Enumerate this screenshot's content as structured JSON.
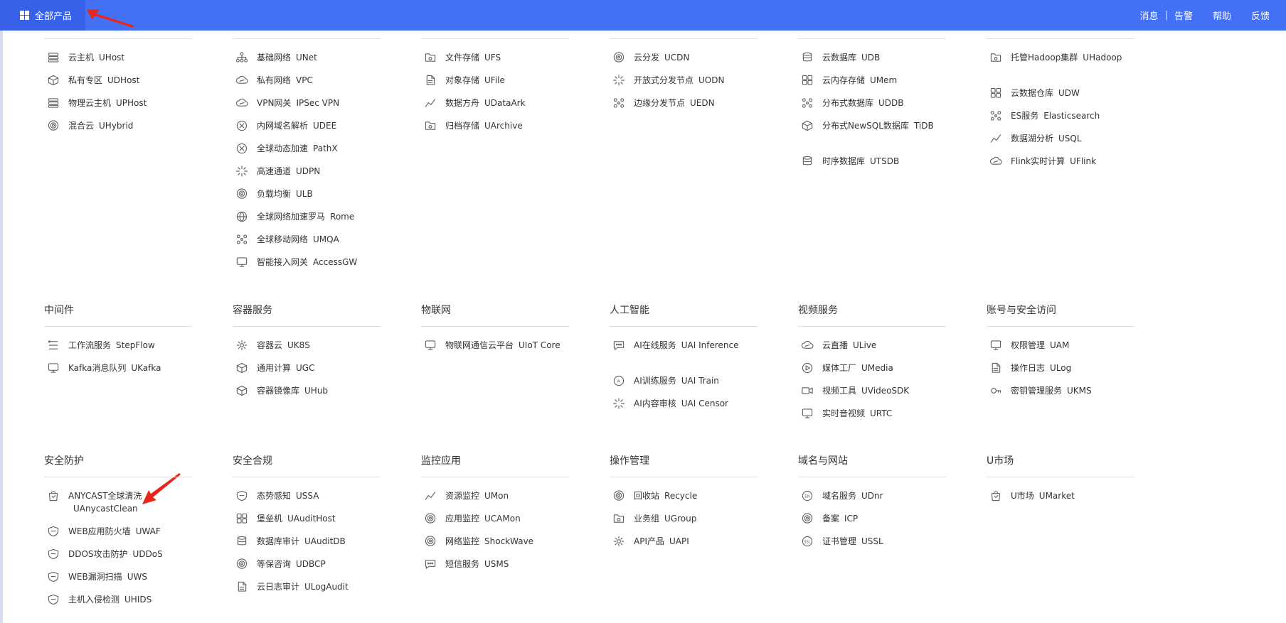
{
  "topbar": {
    "all_products_label": "全部产品",
    "links": [
      "消息",
      "告警",
      "帮助",
      "反馈"
    ]
  },
  "colors": {
    "accent": "#4470f6",
    "accent_dark": "#3761e8",
    "arrow": "#e8261e",
    "icon": "#606266"
  },
  "rows": [
    [
      {
        "title": "",
        "items": [
          {
            "name": "云主机",
            "code": "UHost",
            "icon": "server-icon"
          },
          {
            "name": "私有专区",
            "code": "UDHost",
            "icon": "cube-icon"
          },
          {
            "name": "物理云主机",
            "code": "UPHost",
            "icon": "physical-server-icon"
          },
          {
            "name": "混合云",
            "code": "UHybrid",
            "icon": "target-icon"
          }
        ]
      },
      {
        "title": "",
        "items": [
          {
            "name": "基础网络",
            "code": "UNet",
            "icon": "network-tree-icon"
          },
          {
            "name": "私有网络",
            "code": "VPC",
            "icon": "cloud-link-icon"
          },
          {
            "name": "VPN网关",
            "code": "IPSec VPN",
            "icon": "cloud-link-icon"
          },
          {
            "name": "内网域名解析",
            "code": "UDEE",
            "icon": "dns-icon"
          },
          {
            "name": "全球动态加速",
            "code": "PathX",
            "icon": "accelerate-icon"
          },
          {
            "name": "高速通道",
            "code": "UDPN",
            "icon": "dotted-channel-icon"
          },
          {
            "name": "负载均衡",
            "code": "ULB",
            "icon": "load-balancer-icon"
          },
          {
            "name": "全球网络加速罗马",
            "code": "Rome",
            "icon": "globe-icon"
          },
          {
            "name": "全球移动网络",
            "code": "UMQA",
            "icon": "mobile-network-icon"
          },
          {
            "name": "智能接入网关",
            "code": "AccessGW",
            "icon": "gateway-icon"
          }
        ]
      },
      {
        "title": "",
        "items": [
          {
            "name": "文件存储",
            "code": "UFS",
            "icon": "folder-icon"
          },
          {
            "name": "对象存储",
            "code": "UFile",
            "icon": "file-icon"
          },
          {
            "name": "数据方舟",
            "code": "UDataArk",
            "icon": "ark-icon"
          },
          {
            "name": "归档存储",
            "code": "UArchive",
            "icon": "archive-icon"
          }
        ]
      },
      {
        "title": "",
        "items": [
          {
            "name": "云分发",
            "code": "UCDN",
            "icon": "cdn-icon"
          },
          {
            "name": "开放式分发节点",
            "code": "UODN",
            "icon": "burst-icon"
          },
          {
            "name": "边缘分发节点",
            "code": "UEDN",
            "icon": "nodes-icon"
          }
        ]
      },
      {
        "title": "",
        "items": [
          {
            "name": "云数据库",
            "code": "UDB",
            "icon": "database-icon"
          },
          {
            "name": "云内存存储",
            "code": "UMem",
            "icon": "grid-squares-icon"
          },
          {
            "name": "分布式数据库",
            "code": "UDDB",
            "icon": "distributed-db-icon"
          },
          {
            "name": "分布式NewSQL数据库",
            "code": "TiDB",
            "icon": "tidb-icon",
            "wrap": true
          },
          {
            "name": "时序数据库",
            "code": "UTSDB",
            "icon": "timeseries-db-icon"
          }
        ]
      },
      {
        "title": "",
        "items": [
          {
            "name": "托管Hadoop集群",
            "code": "UHadoop",
            "icon": "hadoop-icon",
            "wrap": true
          },
          {
            "name": "云数据仓库",
            "code": "UDW",
            "icon": "warehouse-icon"
          },
          {
            "name": "ES服务",
            "code": "Elasticsearch",
            "icon": "es-icon"
          },
          {
            "name": "数据湖分析",
            "code": "USQL",
            "icon": "lake-icon"
          },
          {
            "name": "Flink实时计算",
            "code": "UFlink",
            "icon": "flink-icon"
          }
        ]
      }
    ],
    [
      {
        "title": "中间件",
        "items": [
          {
            "name": "工作流服务",
            "code": "StepFlow",
            "icon": "workflow-icon"
          },
          {
            "name": "Kafka消息队列",
            "code": "UKafka",
            "icon": "queue-icon"
          }
        ]
      },
      {
        "title": "容器服务",
        "items": [
          {
            "name": "容器云",
            "code": "UK8S",
            "icon": "k8s-icon"
          },
          {
            "name": "通用计算",
            "code": "UGC",
            "icon": "compute-icon"
          },
          {
            "name": "容器镜像库",
            "code": "UHub",
            "icon": "image-hub-icon"
          }
        ]
      },
      {
        "title": "物联网",
        "items": [
          {
            "name": "物联网通信云平台",
            "code": "UIoT Core",
            "icon": "iot-icon",
            "wrap": true
          }
        ]
      },
      {
        "title": "人工智能",
        "items": [
          {
            "name": "AI在线服务",
            "code": "UAI Inference",
            "icon": "ai-online-icon",
            "wrap": true
          },
          {
            "name": "AI训练服务",
            "code": "UAI Train",
            "icon": "ai-icon"
          },
          {
            "name": "AI内容审核",
            "code": "UAI Censor",
            "icon": "scan-icon"
          }
        ]
      },
      {
        "title": "视频服务",
        "items": [
          {
            "name": "云直播",
            "code": "ULive",
            "icon": "live-icon"
          },
          {
            "name": "媒体工厂",
            "code": "UMedia",
            "icon": "play-icon"
          },
          {
            "name": "视频工具",
            "code": "UVideoSDK",
            "icon": "video-camera-icon"
          },
          {
            "name": "实时音视频",
            "code": "URTC",
            "icon": "rtc-icon"
          }
        ]
      },
      {
        "title": "账号与安全访问",
        "items": [
          {
            "name": "权限管理",
            "code": "UAM",
            "icon": "id-card-icon"
          },
          {
            "name": "操作日志",
            "code": "ULog",
            "icon": "log-icon"
          },
          {
            "name": "密钥管理服务",
            "code": "UKMS",
            "icon": "key-icon"
          }
        ]
      }
    ],
    [
      {
        "title": "安全防护",
        "items": [
          {
            "name": "ANYCAST全球清洗",
            "code": "UAnycastClean",
            "icon": "basket-icon",
            "wrap": true
          },
          {
            "name": "WEB应用防火墙",
            "code": "UWAF",
            "icon": "shield-icon"
          },
          {
            "name": "DDOS攻击防护",
            "code": "UDDoS",
            "icon": "ddos-icon"
          },
          {
            "name": "WEB漏洞扫描",
            "code": "UWS",
            "icon": "shield-scan-icon"
          },
          {
            "name": "主机入侵检测",
            "code": "UHIDS",
            "icon": "shield-lines-icon"
          }
        ]
      },
      {
        "title": "安全合规",
        "items": [
          {
            "name": "态势感知",
            "code": "USSA",
            "icon": "shield-check-icon"
          },
          {
            "name": "堡垒机",
            "code": "UAuditHost",
            "icon": "bastion-icon"
          },
          {
            "name": "数据库审计",
            "code": "UAuditDB",
            "icon": "db-audit-icon"
          },
          {
            "name": "等保咨询",
            "code": "UDBCP",
            "icon": "consult-icon"
          },
          {
            "name": "云日志审计",
            "code": "ULogAudit",
            "icon": "log-audit-icon"
          }
        ]
      },
      {
        "title": "监控应用",
        "items": [
          {
            "name": "资源监控",
            "code": "UMon",
            "icon": "pulse-icon"
          },
          {
            "name": "应用监控",
            "code": "UCAMon",
            "icon": "gauge-icon"
          },
          {
            "name": "网络监控",
            "code": "ShockWave",
            "icon": "ring-icon"
          },
          {
            "name": "短信服务",
            "code": "USMS",
            "icon": "chat-icon"
          }
        ]
      },
      {
        "title": "操作管理",
        "items": [
          {
            "name": "回收站",
            "code": "Recycle",
            "icon": "recycle-icon"
          },
          {
            "name": "业务组",
            "code": "UGroup",
            "icon": "group-icon"
          },
          {
            "name": "API产品",
            "code": "UAPI",
            "icon": "api-icon"
          }
        ]
      },
      {
        "title": "域名与网站",
        "items": [
          {
            "name": "域名服务",
            "code": "UDnr",
            "icon": "domain-icon"
          },
          {
            "name": "备案",
            "code": "ICP",
            "icon": "icp-icon"
          },
          {
            "name": "证书管理",
            "code": "USSL",
            "icon": "ssl-icon"
          }
        ]
      },
      {
        "title": "U市场",
        "items": [
          {
            "name": "U市场",
            "code": "UMarket",
            "icon": "market-bag-icon"
          }
        ]
      }
    ]
  ]
}
